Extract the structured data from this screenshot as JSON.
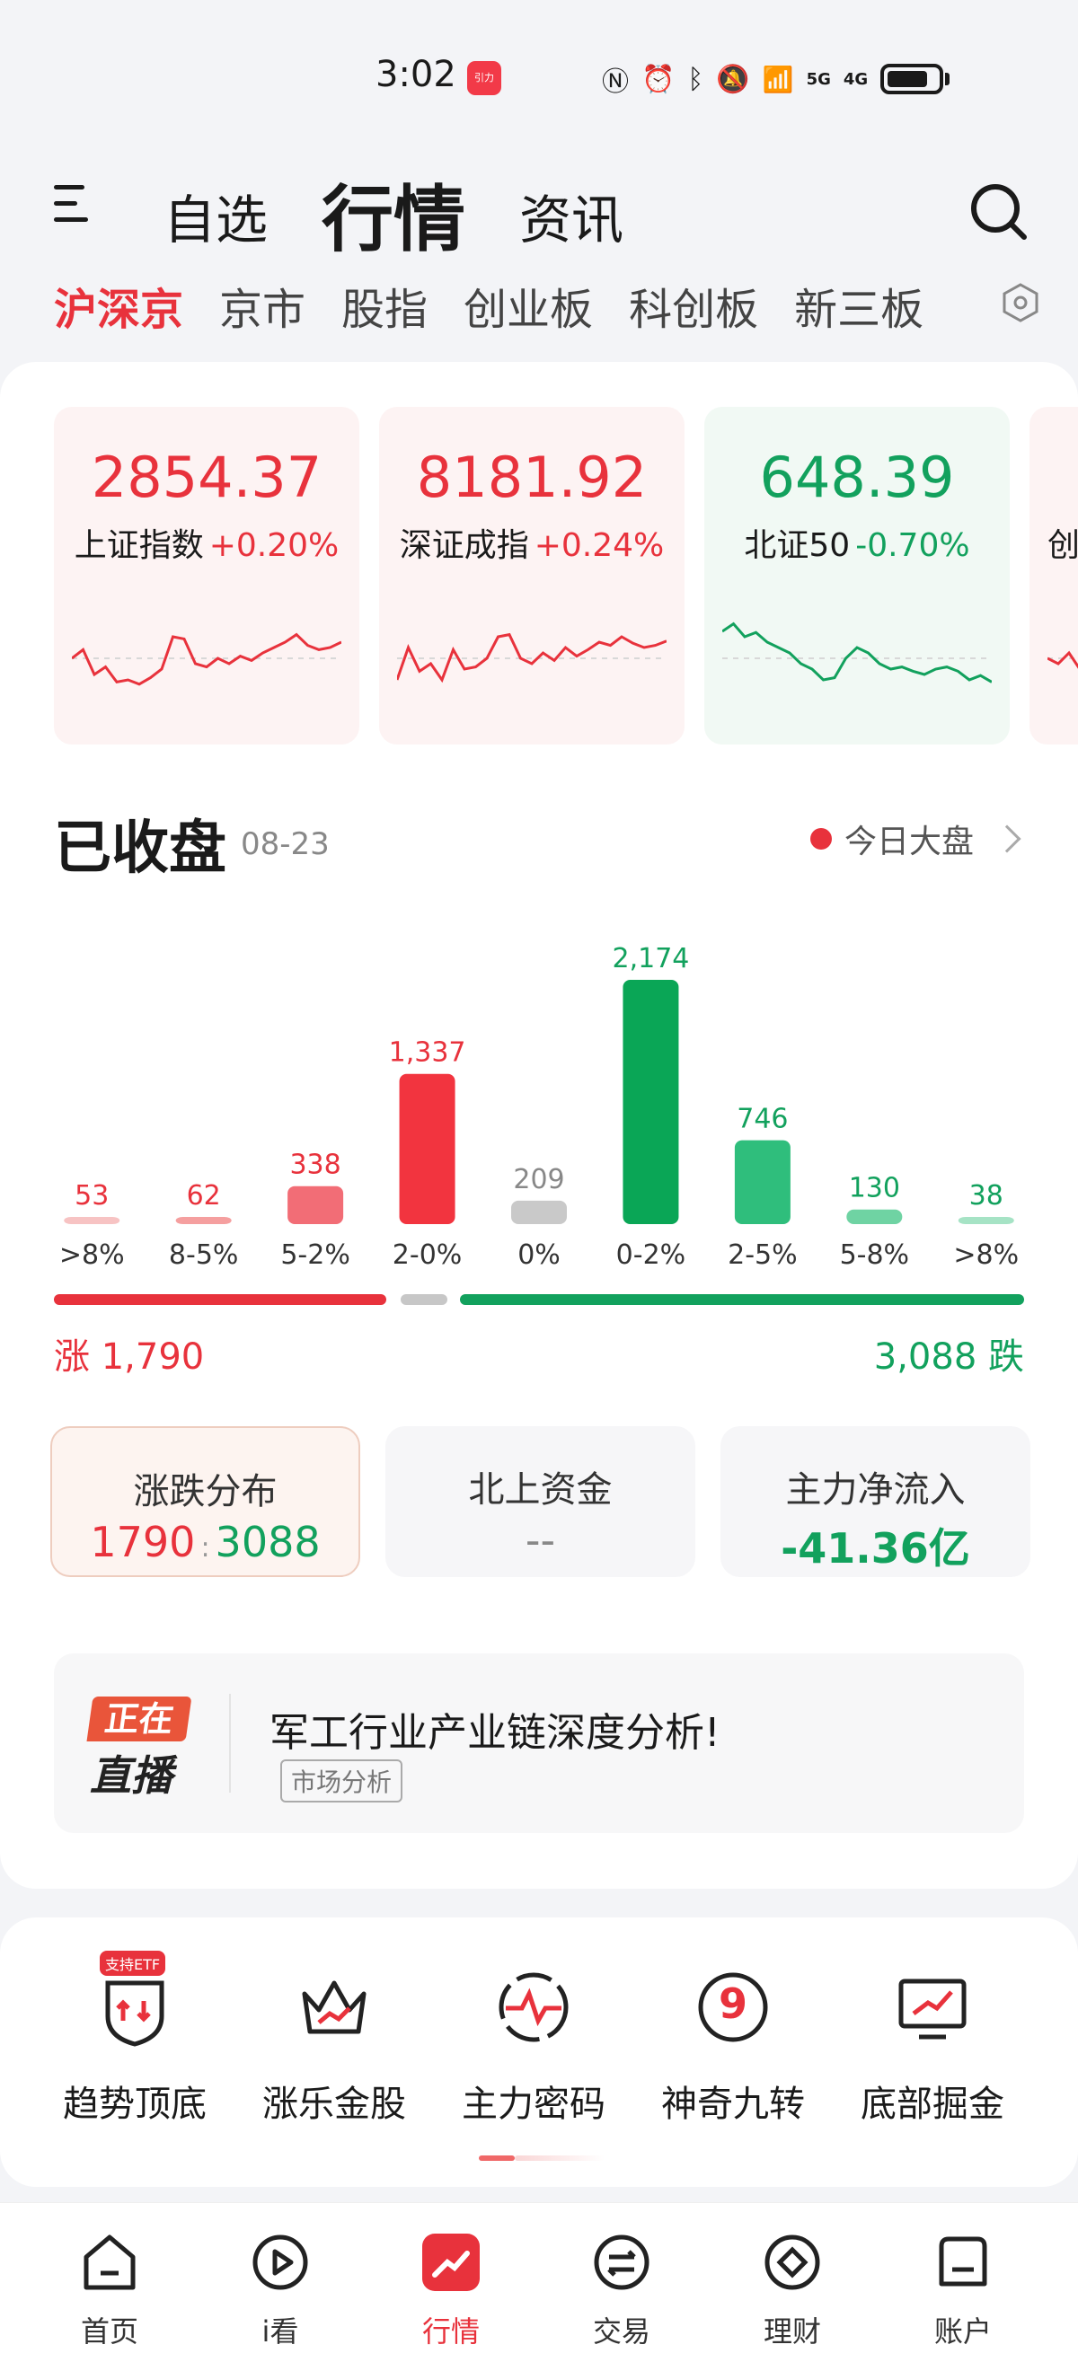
{
  "status": {
    "time": "3:02",
    "app_icon_label": "引力",
    "net1": "5G",
    "net2": "4G"
  },
  "header": {
    "tabs": [
      {
        "label": "自选"
      },
      {
        "label": "行情"
      },
      {
        "label": "资讯"
      }
    ]
  },
  "subtabs": [
    "沪深京",
    "京市",
    "股指",
    "创业板",
    "科创板",
    "新三板"
  ],
  "indices": [
    {
      "value": "2854.37",
      "name": "上证指数",
      "change": "+0.20%",
      "trend": "up",
      "spark": [
        50,
        42,
        65,
        58,
        72,
        70,
        74,
        68,
        60,
        30,
        32,
        55,
        58,
        50,
        55,
        48,
        52,
        45,
        40,
        35,
        28,
        38,
        42,
        40,
        35
      ]
    },
    {
      "value": "8181.92",
      "name": "深证成指",
      "change": "+0.24%",
      "trend": "up",
      "spark": [
        70,
        40,
        62,
        55,
        70,
        42,
        60,
        58,
        50,
        30,
        28,
        50,
        55,
        45,
        52,
        40,
        48,
        42,
        35,
        38,
        30,
        36,
        40,
        38,
        34
      ]
    },
    {
      "value": "648.39",
      "name": "北证50",
      "change": "-0.70%",
      "trend": "down",
      "spark": [
        25,
        18,
        30,
        26,
        35,
        40,
        45,
        55,
        60,
        70,
        68,
        50,
        40,
        45,
        55,
        60,
        58,
        62,
        65,
        60,
        58,
        62,
        70,
        66,
        72
      ]
    },
    {
      "value": "",
      "name": "创",
      "change": "",
      "trend": "up",
      "spark": [
        50,
        55,
        45,
        60,
        52,
        58
      ]
    }
  ],
  "market": {
    "title": "已收盘",
    "date": "08-23",
    "link_label": "今日大盘",
    "up_label": "涨 1,790",
    "down_label": "3,088 跌"
  },
  "chart_data": {
    "type": "bar",
    "categories": [
      ">8%",
      "8-5%",
      "5-2%",
      "2-0%",
      "0%",
      "0-2%",
      "2-5%",
      "5-8%",
      ">8%"
    ],
    "values": [
      53,
      62,
      338,
      1337,
      209,
      2174,
      746,
      130,
      38
    ],
    "value_labels": [
      "53",
      "62",
      "338",
      "1,337",
      "209",
      "2,174",
      "746",
      "130",
      "38"
    ],
    "colors": [
      "#f7c3c3",
      "#f59f9f",
      "#f26d76",
      "#f2343f",
      "#c9c9c9",
      "#0aa656",
      "#2fbe7c",
      "#6fd3a3",
      "#a6e3c5"
    ],
    "label_colors": [
      "#e8323c",
      "#e8323c",
      "#e8323c",
      "#e8323c",
      "#888888",
      "#12a15d",
      "#12a15d",
      "#12a15d",
      "#12a15d"
    ]
  },
  "stats": [
    {
      "label": "涨跌分布",
      "up": "1790",
      "sep": ":",
      "down": "3088"
    },
    {
      "label": "北上资金",
      "value": "--"
    },
    {
      "label": "主力净流入",
      "value": "-41.36亿"
    }
  ],
  "live": {
    "badge_top": "正在",
    "badge_bottom": "直播",
    "title": "军工行业产业链深度分析!",
    "tag": "市场分析"
  },
  "tools": [
    {
      "label": "趋势顶底",
      "badge": "支持ETF"
    },
    {
      "label": "涨乐金股"
    },
    {
      "label": "主力密码"
    },
    {
      "label": "神奇九转",
      "glyph": "9"
    },
    {
      "label": "底部掘金"
    }
  ],
  "bottom_nav": [
    {
      "label": "首页"
    },
    {
      "label": "i看"
    },
    {
      "label": "行情"
    },
    {
      "label": "交易"
    },
    {
      "label": "理财"
    },
    {
      "label": "账户"
    }
  ],
  "colors": {
    "up": "#e8323c",
    "down": "#12a15d",
    "flat": "#c7c7c7"
  }
}
